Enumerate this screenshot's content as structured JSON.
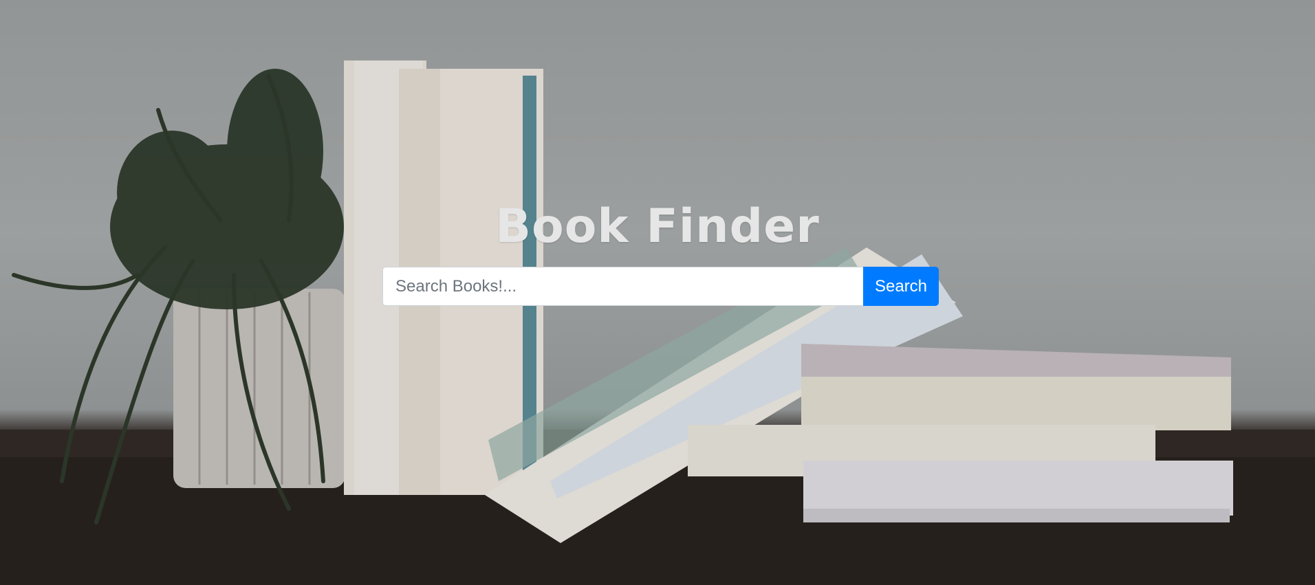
{
  "page": {
    "title": "Book Finder"
  },
  "search": {
    "placeholder": "Search Books!...",
    "value": "",
    "button_label": "Search"
  },
  "background": {
    "description_icon": "books-and-plant-photo"
  },
  "colors": {
    "title": "#e6e6e6",
    "button": "#007bff",
    "button_text": "#ffffff"
  }
}
